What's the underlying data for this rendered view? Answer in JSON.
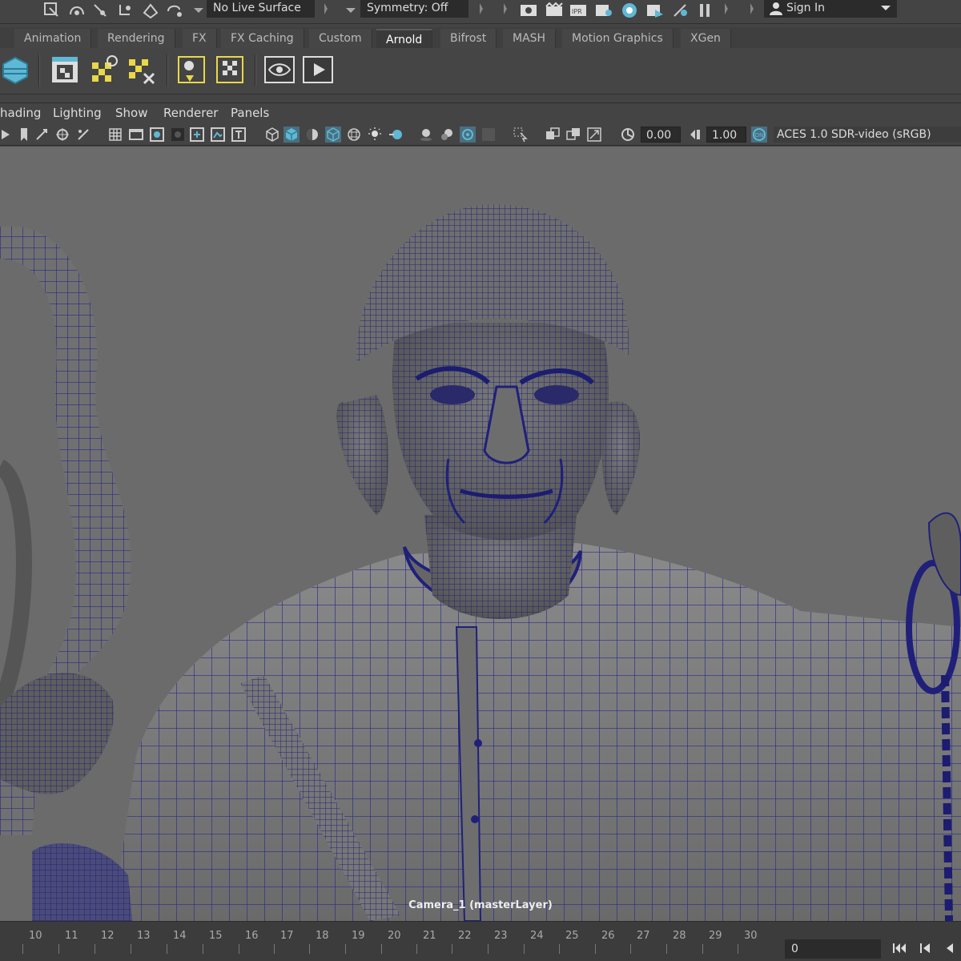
{
  "status_bar": {
    "live_surface": "No Live Surface",
    "symmetry": "Symmetry: Off",
    "sign_in": "Sign In"
  },
  "shelf_tabs": [
    "Animation",
    "Rendering",
    "FX",
    "FX Caching",
    "Custom",
    "Arnold",
    "Bifrost",
    "MASH",
    "Motion Graphics",
    "XGen"
  ],
  "active_shelf_tab": "Arnold",
  "panel_menu": [
    "hading",
    "Lighting",
    "Show",
    "Renderer",
    "Panels"
  ],
  "panel_toolbar": {
    "exposure": "0.00",
    "gamma": "1.00",
    "color_space": "ACES 1.0 SDR-video (sRGB)"
  },
  "viewport": {
    "camera_label": "Camera_1 (masterLayer)",
    "background": "#6b6b6b",
    "wire_color": "#2a2a8c"
  },
  "timeline": {
    "ticks": [
      "10",
      "11",
      "12",
      "13",
      "14",
      "15",
      "16",
      "17",
      "18",
      "19",
      "20",
      "21",
      "22",
      "23",
      "24",
      "25",
      "26",
      "27",
      "28",
      "29",
      "30"
    ],
    "current_frame": "0"
  }
}
